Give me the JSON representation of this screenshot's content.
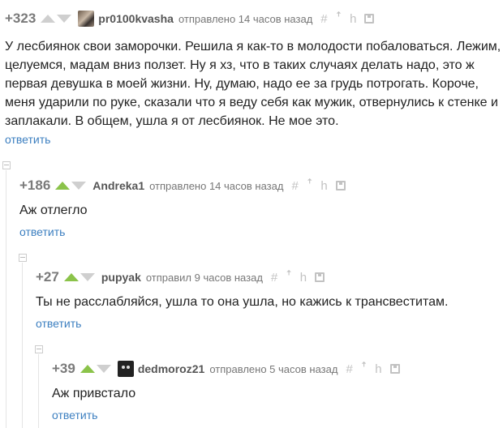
{
  "comments": [
    {
      "rating": "+323",
      "username": "pr0100kvasha",
      "meta": "отправлено 14 часов назад",
      "text": [
        "У лесбиянок свои заморочки. Решила я как-то в молодости побаловаться. Лежим,",
        "целуемся, мадам вниз ползет. Ну я хз, что в таких случаях делать надо, это ж",
        "первая девушка в моей жизни. Ну, думаю, надо ее за грудь потрогать. Короче,",
        "меня ударили по руке, сказали что я веду себя как мужик, отвернулись к стенке и",
        "заплакали. В общем, ушла я от лесбиянок. Не мое это."
      ],
      "reply": "ответить"
    },
    {
      "rating": "+186",
      "username": "Andreka1",
      "meta": "отправлено 14 часов назад",
      "text": [
        "Аж отлегло"
      ],
      "reply": "ответить"
    },
    {
      "rating": "+27",
      "username": "pupyak",
      "meta": "отправил 9 часов назад",
      "text": [
        "Ты не расслабляйся, ушла то она ушла, но кажись к трансвеститам."
      ],
      "reply": "ответить"
    },
    {
      "rating": "+39",
      "username": "dedmoroz21",
      "meta": "отправлено 5 часов назад",
      "text": [
        "Аж привстало"
      ],
      "reply": "ответить"
    }
  ],
  "tool_glyphs": {
    "hash": "#",
    "up": "ꜛ",
    "branch": "h"
  },
  "icons": [
    "vote-up-icon",
    "vote-down-icon",
    "link-hash-icon",
    "parent-arrow-icon",
    "branch-icon",
    "save-icon",
    "collapse-icon"
  ],
  "colors": {
    "accent_green": "#8bc34a",
    "link_blue": "#3c7fc0",
    "muted": "#cfcfcf"
  }
}
